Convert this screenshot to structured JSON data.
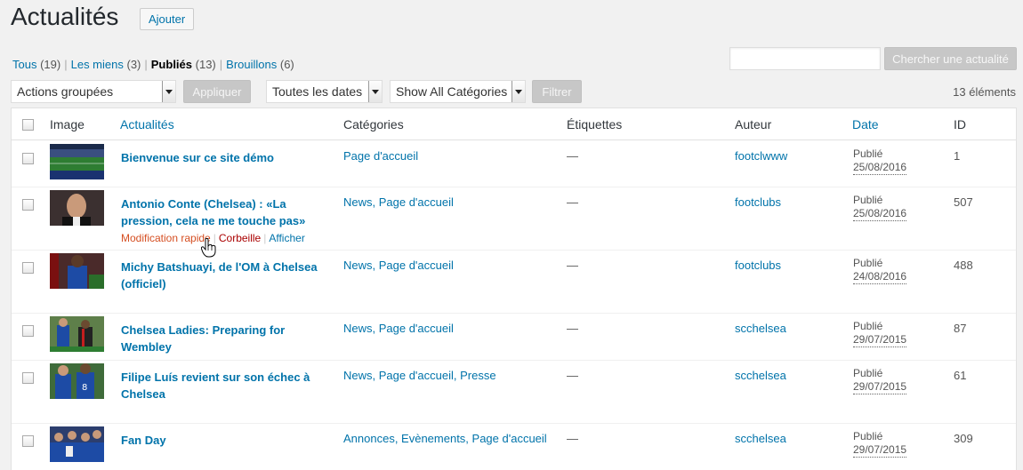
{
  "header": {
    "title": "Actualités",
    "add_label": "Ajouter"
  },
  "filters": [
    {
      "label": "Tous",
      "count": "(19)"
    },
    {
      "label": "Les miens",
      "count": "(3)"
    },
    {
      "label": "Publiés",
      "count": "(13)"
    },
    {
      "label": "Brouillons",
      "count": "(6)"
    }
  ],
  "search": {
    "value": "",
    "button": "Chercher une actualité"
  },
  "bulk": {
    "select": "Actions groupées",
    "apply": "Appliquer"
  },
  "dates_select": "Toutes les dates",
  "cats_select": "Show All Catégories",
  "filter_btn": "Filtrer",
  "items_count": "13 éléments",
  "columns": {
    "image": "Image",
    "title": "Actualités",
    "cats": "Catégories",
    "tags": "Étiquettes",
    "author": "Auteur",
    "date": "Date",
    "id": "ID"
  },
  "row_actions": {
    "quick_edit": "Modification rapide",
    "trash": "Corbeille",
    "view": "Afficher"
  },
  "rows": [
    {
      "title": "Bienvenue sur ce site démo",
      "cats": "Page d'accueil",
      "tags": "—",
      "author": "footclwww",
      "status": "Publié",
      "date": "25/08/2016",
      "id": "1"
    },
    {
      "title": "Antonio Conte (Chelsea) : «La pression, cela ne me touche pas»",
      "cats": "News, Page d'accueil",
      "tags": "—",
      "author": "footclubs",
      "status": "Publié",
      "date": "25/08/2016",
      "id": "507"
    },
    {
      "title": "Michy Batshuayi, de l'OM à Chelsea (officiel)",
      "cats": "News, Page d'accueil",
      "tags": "—",
      "author": "footclubs",
      "status": "Publié",
      "date": "24/08/2016",
      "id": "488"
    },
    {
      "title": "Chelsea Ladies: Preparing for Wembley",
      "cats": "News, Page d'accueil",
      "tags": "—",
      "author": "scchelsea",
      "status": "Publié",
      "date": "29/07/2015",
      "id": "87"
    },
    {
      "title": "Filipe Luís revient sur son échec à Chelsea",
      "cats": "News, Page d'accueil, Presse",
      "tags": "—",
      "author": "scchelsea",
      "status": "Publié",
      "date": "29/07/2015",
      "id": "61"
    },
    {
      "title": "Fan Day",
      "cats": "Annonces, Evènements, Page d'accueil",
      "tags": "—",
      "author": "scchelsea",
      "status": "Publié",
      "date": "29/07/2015",
      "id": "309"
    }
  ]
}
